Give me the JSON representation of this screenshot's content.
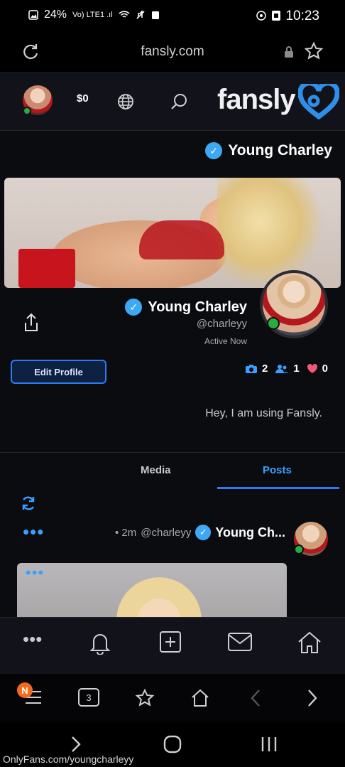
{
  "status_bar": {
    "time": "10:23",
    "battery": "24%",
    "signal": "Vo) LTE1 .ıl"
  },
  "browser": {
    "url": "fansly.com",
    "tab_count": "3",
    "notification_badge": "N"
  },
  "header": {
    "logo": "fansly",
    "wallet": "$0"
  },
  "profile": {
    "title": "Young Charley",
    "display_name": "Young Charley",
    "handle": "@charleyy",
    "status": "Active Now",
    "edit_button": "Edit Profile",
    "likes": "0",
    "followers": "1",
    "media_count": "2",
    "bio": "Hey, I am using Fansly."
  },
  "tabs": {
    "posts": "Posts",
    "media": "Media"
  },
  "post": {
    "author": "Young Ch...",
    "handle": "@charleyy",
    "time": "• 2m",
    "menu": "•••"
  },
  "bottom_nav": {
    "more": "•••"
  },
  "watermark": "OnlyFans.com/youngcharleyy",
  "colors": {
    "accent": "#3aa0ff",
    "button_border": "#2f7af3",
    "online": "#27ae3c",
    "badge": "#f26a1b"
  }
}
